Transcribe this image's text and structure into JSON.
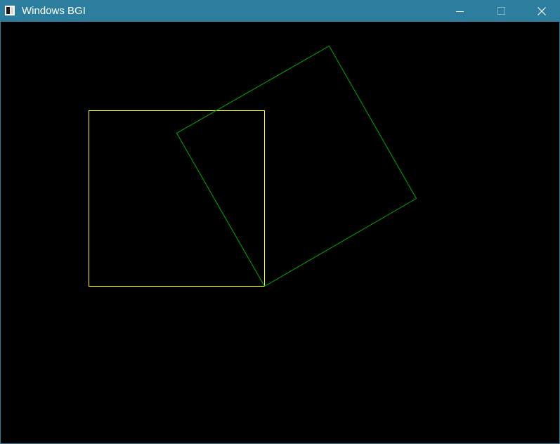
{
  "window": {
    "title": "Windows BGI"
  },
  "titlebar": {
    "icon": "bgi-app-icon",
    "buttons": [
      "minimize-icon",
      "maximize-icon",
      "close-icon"
    ]
  },
  "drawing": {
    "background": "#000000",
    "shapes": [
      {
        "type": "square",
        "color": "#ffff00"
      },
      {
        "type": "rotated-square",
        "color": "#00aa00"
      }
    ]
  },
  "colors": {
    "titlebar": "#2d7e9e",
    "title_text": "#ffffff",
    "canvas": "#000000",
    "square": "#ffff00",
    "rotated_square": "#00aa00"
  }
}
